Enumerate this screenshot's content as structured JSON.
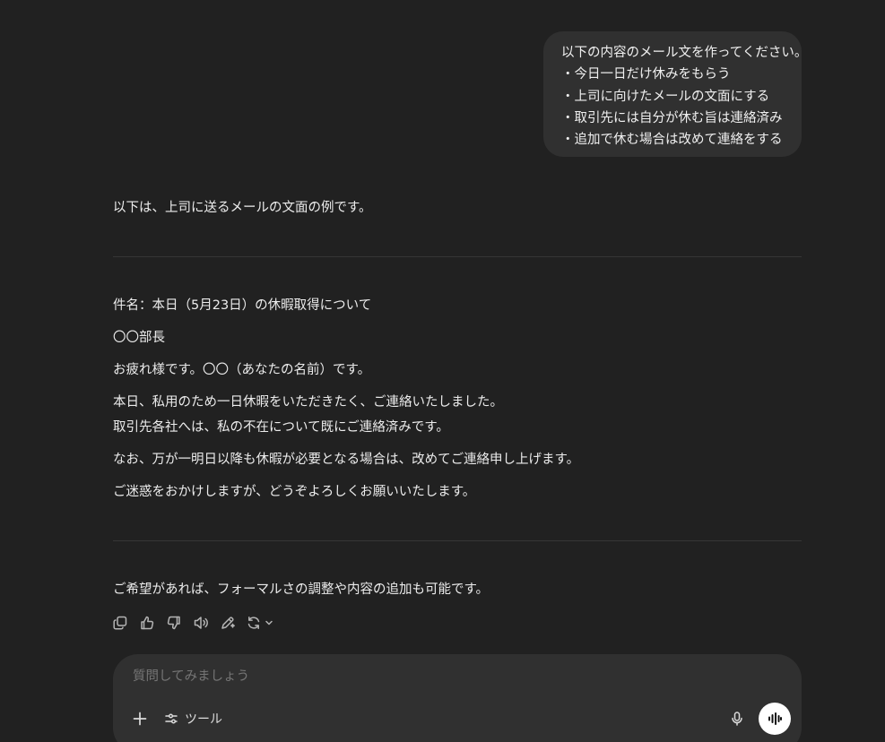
{
  "user_message": {
    "lines": [
      "以下の内容のメール文を作ってください。",
      "・今日一日だけ休みをもらう",
      "・上司に向けたメールの文面にする",
      "・取引先には自分が休む旨は連絡済み",
      "・追加で休む場合は改めて連絡をする"
    ]
  },
  "assistant_message": {
    "intro": "以下は、上司に送るメールの文面の例です。",
    "email": {
      "subject": "件名：本日（5月23日）の休暇取得について",
      "addressee": "〇〇部長",
      "greeting": "お疲れ様です。〇〇（あなたの名前）です。",
      "body_line1": "本日、私用のため一日休暇をいただきたく、ご連絡いたしました。",
      "body_line2": "取引先各社へは、私の不在について既にご連絡済みです。",
      "body_line3": "なお、万が一明日以降も休暇が必要となる場合は、改めてご連絡申し上げます。",
      "closing": "ご迷惑をおかけしますが、どうぞよろしくお願いいたします。"
    },
    "outro": "ご希望があれば、フォーマルさの調整や内容の追加も可能です。"
  },
  "action_icons": [
    "copy-icon",
    "thumbs-up-icon",
    "thumbs-down-icon",
    "read-aloud-icon",
    "edit-icon",
    "regenerate-icon"
  ],
  "composer": {
    "placeholder": "質問してみましょう",
    "tools_label": "ツール"
  },
  "colors": {
    "background": "#212121",
    "bubble": "#303030",
    "composer": "#303030",
    "text": "#ececec",
    "muted": "#9b9b9b"
  }
}
